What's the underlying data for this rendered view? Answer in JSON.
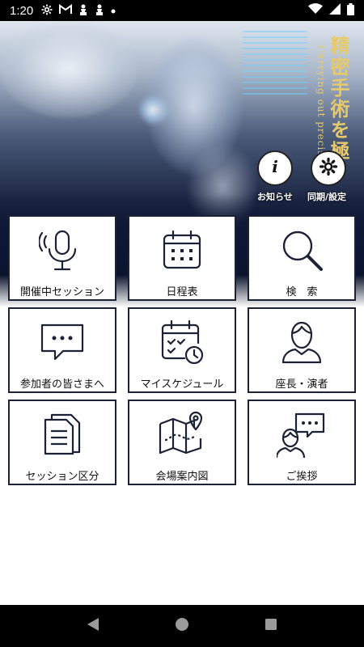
{
  "status_bar": {
    "time": "1:20",
    "left_icons": [
      "gear-icon",
      "gmail-icon",
      "pawn-icon",
      "pawn-icon",
      "dot-icon"
    ],
    "right_icons": [
      "wifi-icon",
      "signal-icon",
      "battery-icon"
    ]
  },
  "hero": {
    "tagline_ja": "精密手術を極",
    "tagline_en": "Carrying out precision"
  },
  "top_buttons": [
    {
      "label": "お知らせ",
      "icon": "info-icon"
    },
    {
      "label": "同期/設定",
      "icon": "gear-icon"
    }
  ],
  "tiles": [
    {
      "label": "開催中セッション",
      "icon": "microphone-icon"
    },
    {
      "label": "日程表",
      "icon": "calendar-icon"
    },
    {
      "label": "検　索",
      "icon": "search-icon"
    },
    {
      "label": "参加者の皆さまへ",
      "icon": "chat-bubble-icon"
    },
    {
      "label": "マイスケジュール",
      "icon": "calendar-clock-icon"
    },
    {
      "label": "座長・演者",
      "icon": "person-icon"
    },
    {
      "label": "セッション区分",
      "icon": "documents-icon"
    },
    {
      "label": "会場案内図",
      "icon": "map-icon"
    },
    {
      "label": "ご挨拶",
      "icon": "speaker-bubble-icon"
    }
  ],
  "nav_bar": [
    "back-icon",
    "home-icon",
    "recents-icon"
  ]
}
